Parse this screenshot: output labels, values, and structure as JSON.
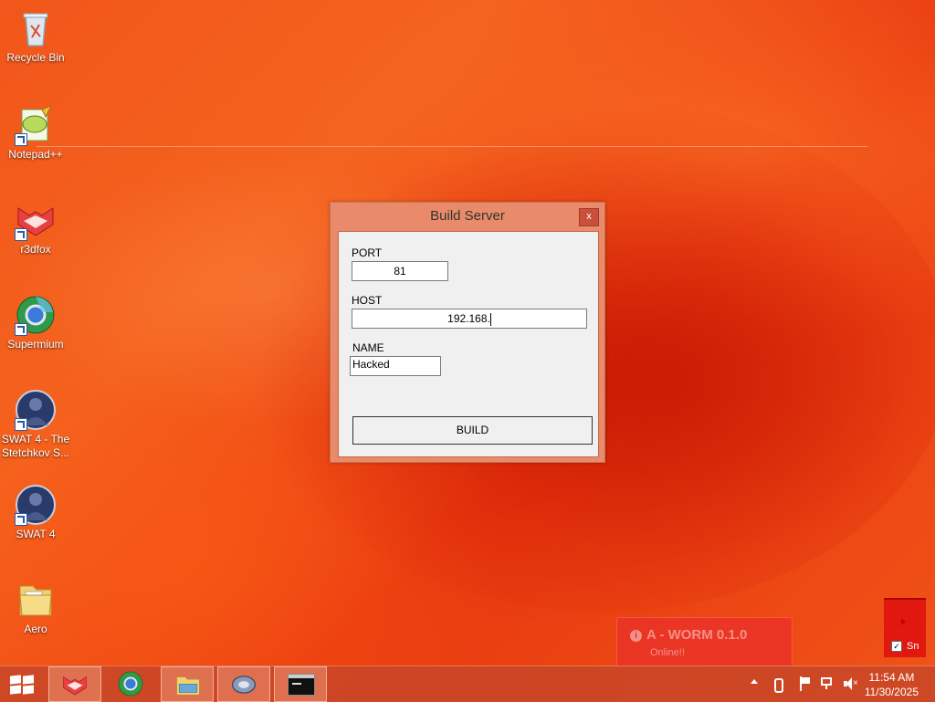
{
  "desktop": {
    "icons": [
      {
        "label": "Recycle Bin"
      },
      {
        "label": "Notepad++"
      },
      {
        "label": "r3dfox"
      },
      {
        "label": "Supermium"
      },
      {
        "label": "SWAT 4 - The Stetchkov S..."
      },
      {
        "label": "SWAT 4"
      },
      {
        "label": "Aero"
      }
    ]
  },
  "dialog": {
    "title": "Build Server",
    "close_label": "x",
    "port_label": "PORT",
    "port_value": "81",
    "host_label": "HOST",
    "host_value": "192.168.",
    "name_label": "NAME",
    "name_value": "Hacked",
    "build_label": "BUILD"
  },
  "notification": {
    "title": "A - WORM 0.1.0",
    "status": "Online!!"
  },
  "side_panel": {
    "checkbox_label": "Sn"
  },
  "taskbar": {
    "time": "11:54 AM",
    "date": "11/30/2025"
  },
  "colors": {
    "accent": "#e98b6a",
    "taskbar": "#c84628",
    "desktop": "#f2561a"
  }
}
